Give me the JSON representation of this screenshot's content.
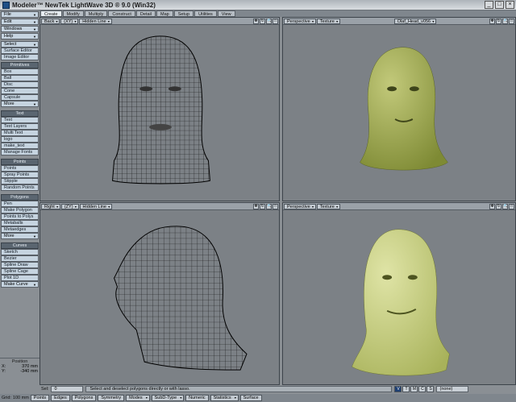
{
  "window": {
    "title": "Modeler™ NewTek LightWave 3D ® 9.0 (Win32)",
    "minimize_icon": "minimize-icon",
    "maximize_icon": "maximize-icon",
    "close_icon": "close-icon"
  },
  "tabs": [
    {
      "label": "Create",
      "active": true
    },
    {
      "label": "Modify"
    },
    {
      "label": "Multiply"
    },
    {
      "label": "Construct"
    },
    {
      "label": "Detail"
    },
    {
      "label": "Map"
    },
    {
      "label": "Setup"
    },
    {
      "label": "Utilities"
    },
    {
      "label": "View"
    }
  ],
  "sidebar": {
    "top": [
      "File",
      "Edit",
      "Windows",
      "Help"
    ],
    "select": "Select",
    "editors": [
      "Surface Editor",
      "Image Editor"
    ],
    "primitives_header": "Primitives",
    "primitives": [
      "Box",
      "Ball",
      "Disc",
      "Cone",
      "Capsule",
      "More"
    ],
    "text_header": "Text",
    "text": [
      "Text",
      "Text Layers",
      "Multi Text",
      "logo",
      "make_text",
      "Manage Fonts"
    ],
    "points_header": "Points",
    "points": [
      "Points",
      "Spray Points",
      "Stipple",
      "Random Points"
    ],
    "polygons_header": "Polygons",
    "polygons": [
      "Pen",
      "Make Polygon",
      "Points to Polys",
      "Metaballs",
      "Metaedges",
      "More"
    ],
    "curves_header": "Curves",
    "curves": [
      "Sketch",
      "Bezier",
      "Spline Draw",
      "Spline Cage",
      "Plot 1D",
      "Make Curve"
    ]
  },
  "position": {
    "title": "Position",
    "x_label": "X:",
    "x_value": "370 mm",
    "y_label": "Y:",
    "y_value": "-340 mm"
  },
  "viewports": {
    "top_left": {
      "view": "Back",
      "axis": "(XY)",
      "mode": "Hidden Line"
    },
    "top_right": {
      "view": "Perspective",
      "mode": "Texture",
      "object": "Olaf_Head_v056"
    },
    "bottom_left": {
      "view": "Right",
      "axis": "(ZY)",
      "mode": "Hidden Line"
    },
    "bottom_right": {
      "view": "Perspective",
      "mode": "Texture"
    }
  },
  "statusbar": {
    "sel_label": "Sel:",
    "sel_value": "0",
    "message": "Select and deselect polygons directly or with lasso.",
    "buttons": [
      "V",
      "T",
      "M",
      "C",
      "S"
    ],
    "surface_value": "(none)"
  },
  "bottombar": {
    "grid_label": "Grid:",
    "grid_value": "100 mm",
    "points": "Points",
    "edges": "Edges",
    "polygons": "Polygons",
    "symmetry": "Symmetry",
    "modes": "Modes",
    "subd_type": "SubD-Type",
    "numeric": "Numeric",
    "statistics": "Statistics",
    "surface": "Surface"
  },
  "colors": {
    "head_fill": "#7e8a34",
    "head_highlight": "#c2c97a",
    "head_fill_bottom": "#a8b25a",
    "highlight_bottom": "#dfe4a6"
  }
}
